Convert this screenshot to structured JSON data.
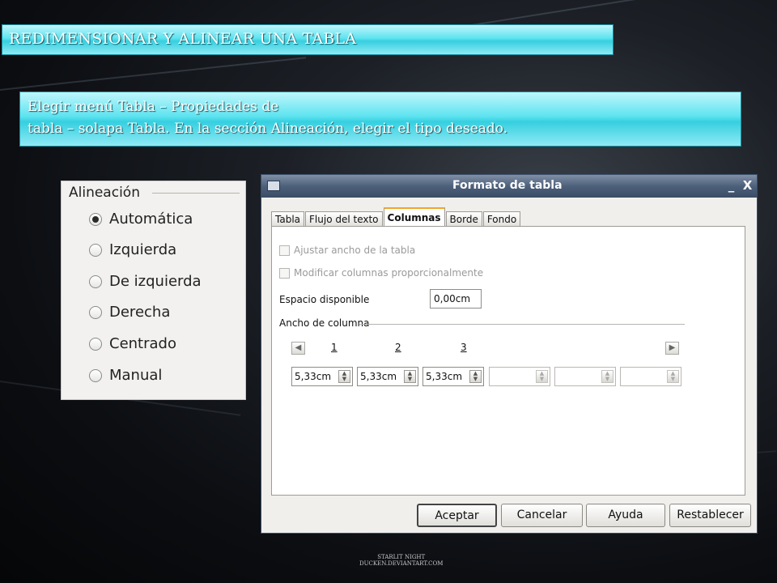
{
  "slide": {
    "title": "REDIMENSIONAR Y ALINEAR UNA TABLA",
    "instruction_line1": "Elegir menú Tabla – Propiedades de",
    "instruction_line2": "tabla – solapa Tabla. En la sección Alineación, elegir el tipo deseado.",
    "credit_line1": "STARLIT NIGHT",
    "credit_line2": "DUCKEN.DEVIANTART.COM"
  },
  "alignment_panel": {
    "legend": "Alineación",
    "options": [
      {
        "label": "Automática",
        "selected": true
      },
      {
        "label": "Izquierda",
        "selected": false
      },
      {
        "label": "De izquierda",
        "selected": false
      },
      {
        "label": "Derecha",
        "selected": false
      },
      {
        "label": "Centrado",
        "selected": false
      },
      {
        "label": "Manual",
        "selected": false
      }
    ]
  },
  "dialog": {
    "title": "Formato de tabla",
    "minimize_symbol": "_",
    "close_symbol": "X",
    "tabs": [
      "Tabla",
      "Flujo del texto",
      "Columnas",
      "Borde",
      "Fondo"
    ],
    "active_tab": "Columnas",
    "checkbox_fit_width": "Ajustar ancho de la tabla",
    "checkbox_proportional": "Modificar columnas proporcionalmente",
    "available_space_label": "Espacio disponible",
    "available_space_value": "0,00cm",
    "column_width_label": "Ancho de columna",
    "column_numbers": [
      "1",
      "2",
      "3"
    ],
    "column_values": [
      "5,33cm",
      "5,33cm",
      "5,33cm",
      "",
      "",
      ""
    ],
    "buttons": {
      "ok": "Aceptar",
      "cancel": "Cancelar",
      "help": "Ayuda",
      "reset": "Restablecer"
    }
  }
}
